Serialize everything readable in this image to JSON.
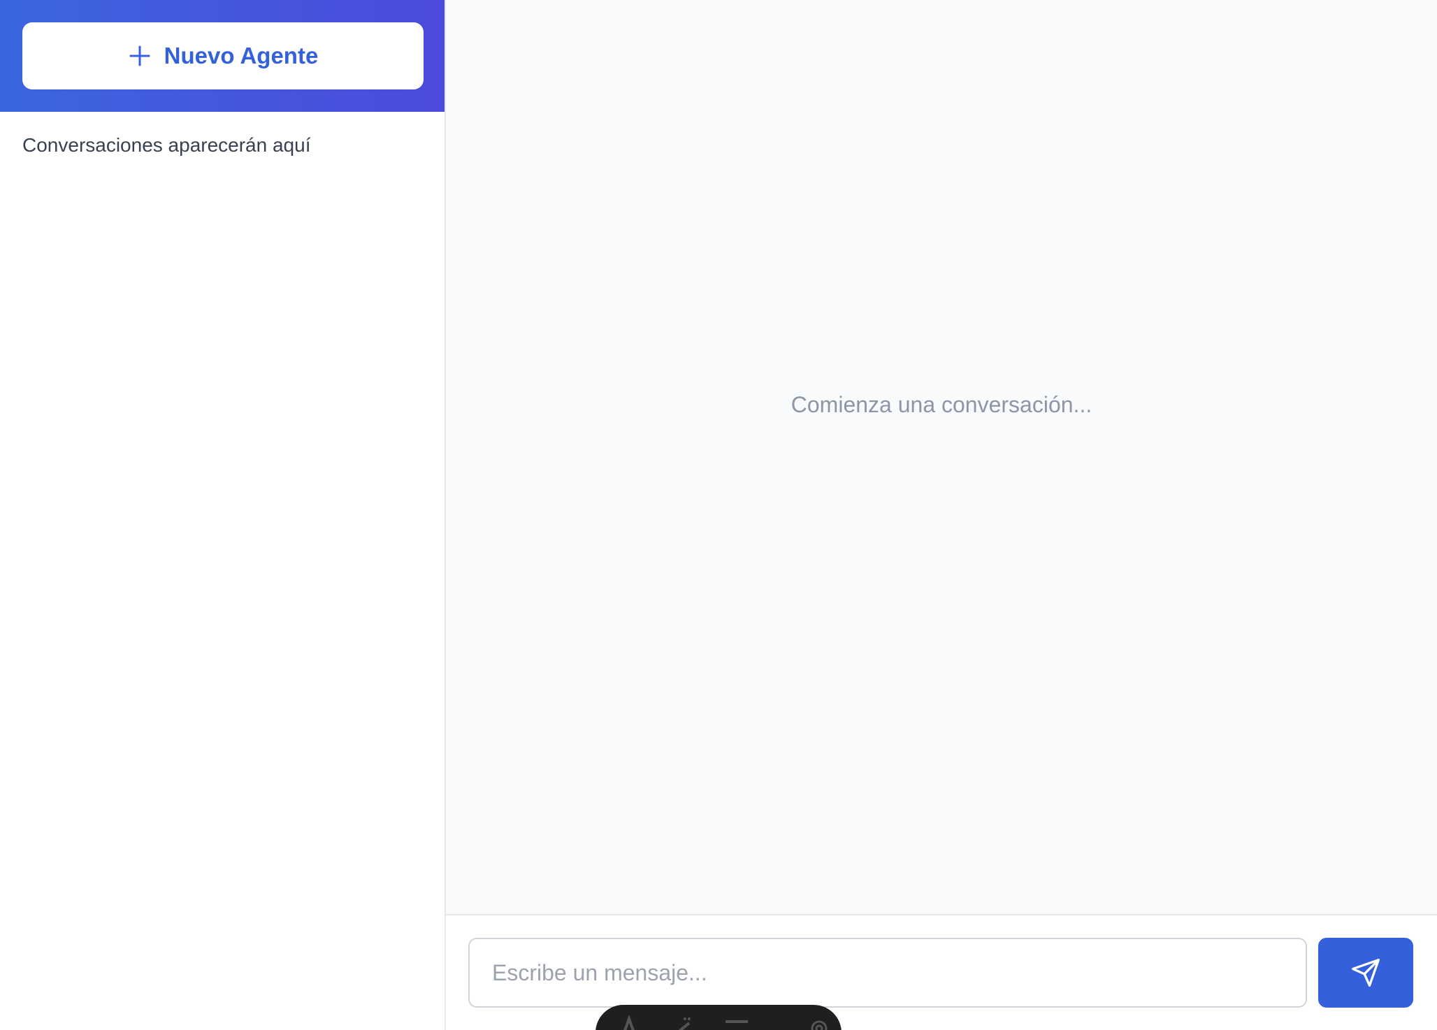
{
  "sidebar": {
    "new_agent_label": "Nuevo Agente",
    "new_agent_icon": "plus-icon",
    "empty_text": "Conversaciones aparecerán aquí"
  },
  "chat": {
    "empty_text": "Comienza una conversación...",
    "input_placeholder": "Escribe un mensaje...",
    "input_value": "",
    "send_icon": "send-icon"
  },
  "toolbar": {
    "icons": [
      "text-icon",
      "brush-icon",
      "line-icon",
      "settings-icon"
    ]
  },
  "colors": {
    "accent": "#3461db",
    "header_gradient_start": "#3b66e0",
    "header_gradient_end": "#4d4adc",
    "muted_text": "#8c96a8",
    "main_background": "#f9fafb"
  }
}
